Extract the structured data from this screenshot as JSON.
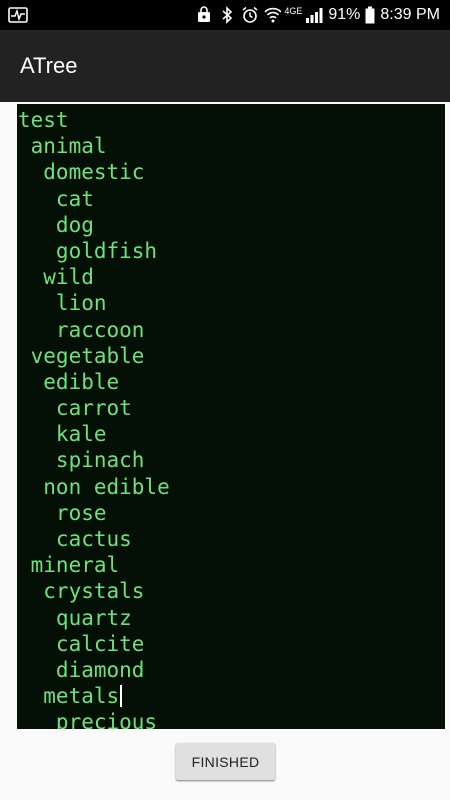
{
  "status_bar": {
    "battery_percent": "91%",
    "time": "8:39 PM",
    "network_label": "4GE",
    "icons": [
      "activity-icon",
      "cast-lock-icon",
      "bluetooth-icon",
      "alarm-icon",
      "wifi-icon",
      "signal-icon",
      "battery-icon"
    ]
  },
  "app_bar": {
    "title": "ATree"
  },
  "tree": {
    "lines": [
      "test",
      " animal",
      "  domestic",
      "   cat",
      "   dog",
      "   goldfish",
      "  wild",
      "   lion",
      "   raccoon",
      " vegetable",
      "  edible",
      "   carrot",
      "   kale",
      "   spinach",
      "  non edible",
      "   rose",
      "   cactus",
      " mineral",
      "  crystals",
      "   quartz",
      "   calcite",
      "   diamond",
      "  metals",
      "   precious"
    ],
    "colors": {
      "background": "#041005",
      "text": "#6ee27a"
    }
  },
  "actions": {
    "finished_label": "FINISHED"
  }
}
